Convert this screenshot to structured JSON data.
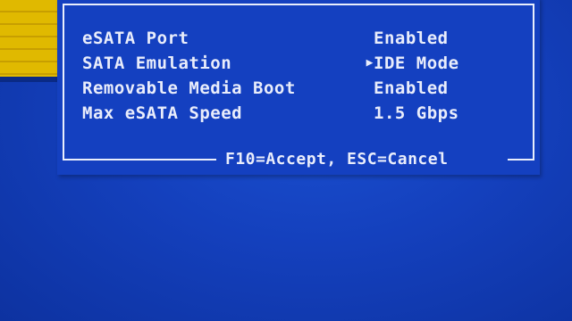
{
  "dialog": {
    "rows": [
      {
        "label": "eSATA Port",
        "value": "Enabled",
        "selected": false
      },
      {
        "label": "SATA Emulation",
        "value": "IDE Mode",
        "selected": true
      },
      {
        "label": "Removable Media Boot",
        "value": "Enabled",
        "selected": false
      },
      {
        "label": "Max eSATA Speed",
        "value": "1.5 Gbps",
        "selected": false
      }
    ],
    "cursor_glyph": "▶",
    "footer": "F10=Accept, ESC=Cancel"
  },
  "colors": {
    "background": "#1440bd",
    "text": "#e9edfb",
    "accent_strip": "#e0b900"
  }
}
